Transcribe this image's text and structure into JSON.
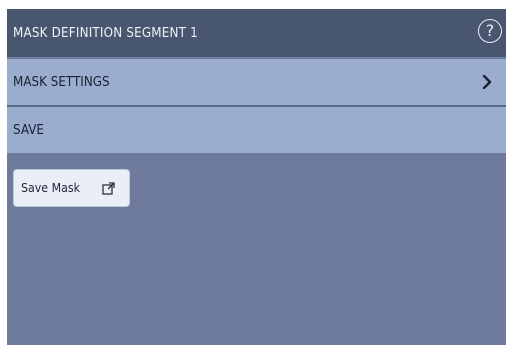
{
  "header": {
    "title": "MASK DEFINITION SEGMENT  1",
    "help_icon": "?"
  },
  "menu": {
    "mask_settings_label": "MASK SETTINGS",
    "save_label": "SAVE"
  },
  "actions": {
    "save_mask_label": "Save Mask"
  },
  "icons": {
    "help": "help-circle-icon",
    "chevron": "chevron-right-icon",
    "external": "external-link-icon"
  },
  "colors": {
    "title_bar": "#48566f",
    "menu_row": "#9aadcf",
    "panel_bg": "#6e7b9c",
    "button_bg": "#e9eef7"
  }
}
